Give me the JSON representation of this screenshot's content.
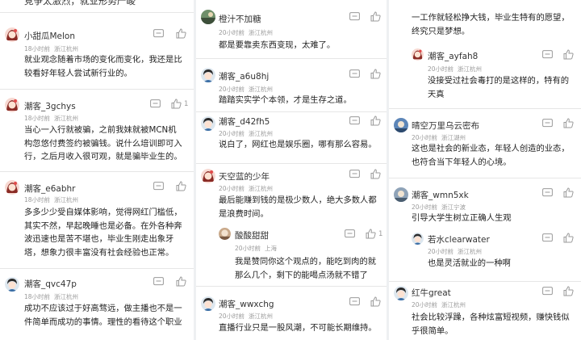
{
  "columns": [
    {
      "top_cut_text": "竞争太激烈，就业形势严峻",
      "comments": [
        {
          "avatar": "girl-avatar",
          "username": "小甜瓜Melon",
          "time": "18小时前",
          "location": "浙江杭州",
          "text": [
            "就业观念随着市场的变化而变化，我还是比",
            "较看好年轻人尝试新行业的。"
          ]
        },
        {
          "avatar": "girl-avatar",
          "username": "潮客_3gchys",
          "time": "18小时前",
          "location": "浙江杭州",
          "likes": "1",
          "text": [
            "当心一入行就被骗，之前我妹就被MCN机",
            "构忽悠付费签约被骗钱。说什么培训即可入",
            "行，之后月收入很可观，就是骗毕业生的。"
          ]
        },
        {
          "avatar": "girl-avatar",
          "username": "潮客_e6abhr",
          "time": "18小时前",
          "location": "浙江杭州",
          "text": [
            "多多少少受自媒体影响，觉得网红门槛低，",
            "其实不然，早起晚睡也是必备。在外各种奔",
            "波迅速也是苦不堪也，毕业生刚走出象牙",
            "塔，想象力很丰富没有社会经验也正常。"
          ]
        },
        {
          "avatar": "boy-avatar",
          "username": "潮客_qvc47p",
          "time": "18小时前",
          "location": "浙江杭州",
          "text": [
            "成功不应该过于好高骛远，做主播也不是一",
            "件简单而成功的事情。理性的看待这个职业"
          ]
        }
      ]
    },
    {
      "comments": [
        {
          "avatar": "photo-avatar",
          "username": "橙汁不加糖",
          "time": "20小时前",
          "location": "浙江杭州",
          "text": [
            "都是要靠卖东西变现，太难了。"
          ]
        },
        {
          "avatar": "boy-avatar",
          "username": "潮客_a6u8hj",
          "time": "20小时前",
          "location": "浙江杭州",
          "text": [
            "踏踏实实学个本领，才是生存之道。"
          ]
        },
        {
          "avatar": "boy-avatar",
          "username": "潮客_d42fh5",
          "time": "20小时前",
          "location": "浙江杭州",
          "text": [
            "说白了，网红也是娱乐圈，哪有那么容易。"
          ]
        },
        {
          "avatar": "girl-avatar",
          "username": "天空蓝的少年",
          "time": "20小时前",
          "location": "浙江杭州",
          "text": [
            "最后能赚到钱的是极少数人，绝大多数人都",
            "是浪费时间。"
          ],
          "reply": {
            "avatar": "photo-avatar",
            "username": "酸酸甜甜",
            "time": "20小时前",
            "location": "上海",
            "likes": "1",
            "text": [
              "我是赞同你这个观点的，能吃到肉的就",
              "那么几个，剩下的能喝点汤就不错了"
            ]
          }
        },
        {
          "avatar": "boy-avatar",
          "username": "潮客_wwxchg",
          "time": "20小时前",
          "location": "浙江杭州",
          "text": [
            "直播行业只是一股风潮，不可能长期维持。"
          ]
        }
      ]
    },
    {
      "top_cut_text": [
        "一工作就轻松挣大钱，毕业生特有的愿望，",
        "终究只是梦想。"
      ],
      "comments": [
        {
          "is_reply": true,
          "avatar": "girl-avatar",
          "username": "潮客_ayfah8",
          "time": "20小时前",
          "location": "浙江杭州",
          "text": [
            "没接受过社会毒打的是这样的，特有的",
            "天真"
          ]
        },
        {
          "avatar": "photo-avatar",
          "username": "晴空万里乌云密布",
          "time": "20小时前",
          "location": "浙江湖州",
          "text": [
            "这也是社会的新业态，年轻人创造的业态，",
            "也符合当下年轻人的心境。"
          ]
        },
        {
          "avatar": "photo-avatar",
          "username": "潮客_wmn5xk",
          "time": "20小时前",
          "location": "浙江宁波",
          "text": [
            "引导大学生树立正确人生观"
          ],
          "reply": {
            "avatar": "boy-avatar",
            "username": "若水clearwater",
            "time": "20小时前",
            "location": "浙江杭州",
            "text": [
              "也是灵活就业的一种啊"
            ]
          }
        },
        {
          "avatar": "boy-avatar",
          "username": "红牛great",
          "time": "20小时前",
          "location": "浙江杭州",
          "text": [
            "社会比较浮躁，各种炫富短视频，赚快钱似",
            "乎很简单。"
          ]
        }
      ]
    }
  ]
}
